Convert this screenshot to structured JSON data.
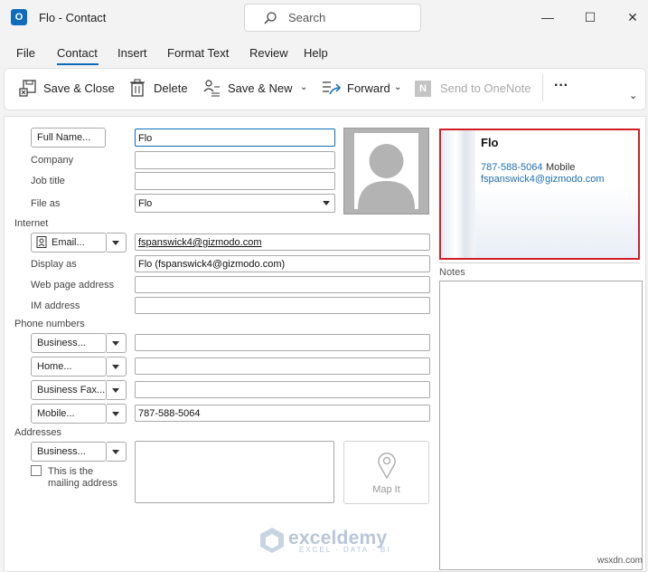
{
  "window": {
    "title": "Flo  -  Contact",
    "app_icon_letter": "O",
    "search_placeholder": "Search"
  },
  "window_controls": {
    "minimize": "—",
    "maximize": "☐",
    "close": "✕"
  },
  "menu": [
    "File",
    "Contact",
    "Insert",
    "Format Text",
    "Review",
    "Help"
  ],
  "ribbon": {
    "save_close": "Save & Close",
    "delete": "Delete",
    "save_new": "Save & New",
    "forward": "Forward",
    "send_onenote": "Send to OneNote",
    "more": "···"
  },
  "form": {
    "full_name_button": "Full Name...",
    "full_name": "Flo",
    "company_label": "Company",
    "company": "",
    "job_title_label": "Job title",
    "job_title": "",
    "file_as_label": "File as",
    "file_as": "Flo",
    "internet_section": "Internet",
    "email_button": "Email...",
    "email": "fspanswick4@gizmodo.com",
    "display_as_label": "Display as",
    "display_as": "Flo (fspanswick4@gizmodo.com)",
    "web_label": "Web page address",
    "web": "",
    "im_label": "IM address",
    "im": "",
    "phone_section": "Phone numbers",
    "phones": [
      {
        "type": "Business...",
        "value": ""
      },
      {
        "type": "Home...",
        "value": ""
      },
      {
        "type": "Business Fax...",
        "value": ""
      },
      {
        "type": "Mobile...",
        "value": "787-588-5064"
      }
    ],
    "addresses_section": "Addresses",
    "address_type": "Business...",
    "mailing_checkbox_line1": "This is the",
    "mailing_checkbox_line2": "mailing address",
    "map_it": "Map It"
  },
  "business_card": {
    "name": "Flo",
    "phone": "787-588-5064",
    "phone_type": "Mobile",
    "email": "fspanswick4@gizmodo.com"
  },
  "notes_label": "Notes",
  "watermark": {
    "brand": "exceldemy",
    "tagline": "EXCEL · DATA · BI"
  },
  "site": "wsxdn.com",
  "colors": {
    "accent": "#0f6cbd",
    "card_border": "#d21f26",
    "link": "#1f6fb5"
  }
}
